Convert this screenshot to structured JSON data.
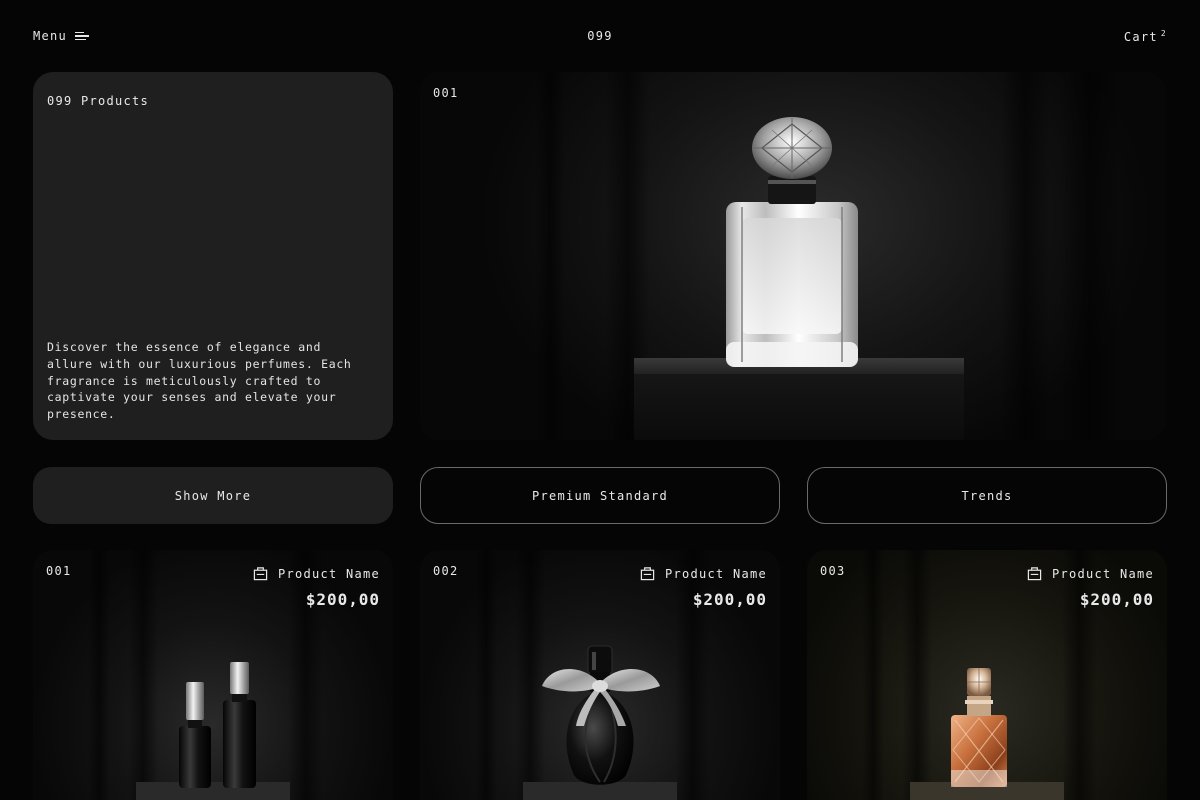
{
  "header": {
    "menu_label": "Menu",
    "brand": "099",
    "cart_label": "Cart",
    "cart_count": "2"
  },
  "intro": {
    "title": "099 Products",
    "description": "Discover the essence of elegance and allure with our luxurious perfumes. Each fragrance is meticulously crafted to captivate your senses and elevate your presence."
  },
  "hero": {
    "number": "001"
  },
  "buttons": {
    "show_more": "Show More",
    "premium": "Premium Standard",
    "trends": "Trends"
  },
  "products": [
    {
      "number": "001",
      "name": "Product Name",
      "price": "$200,00",
      "icon": "shopping-bag-icon"
    },
    {
      "number": "002",
      "name": "Product Name",
      "price": "$200,00",
      "icon": "shopping-bag-icon"
    },
    {
      "number": "003",
      "name": "Product Name",
      "price": "$200,00",
      "icon": "shopping-bag-icon"
    }
  ],
  "colors": {
    "background": "#050505",
    "card": "#1f1f1f",
    "text": "#e8e8e8",
    "outline": "#6a6a6a",
    "amber_perfume": "#c8703e"
  }
}
